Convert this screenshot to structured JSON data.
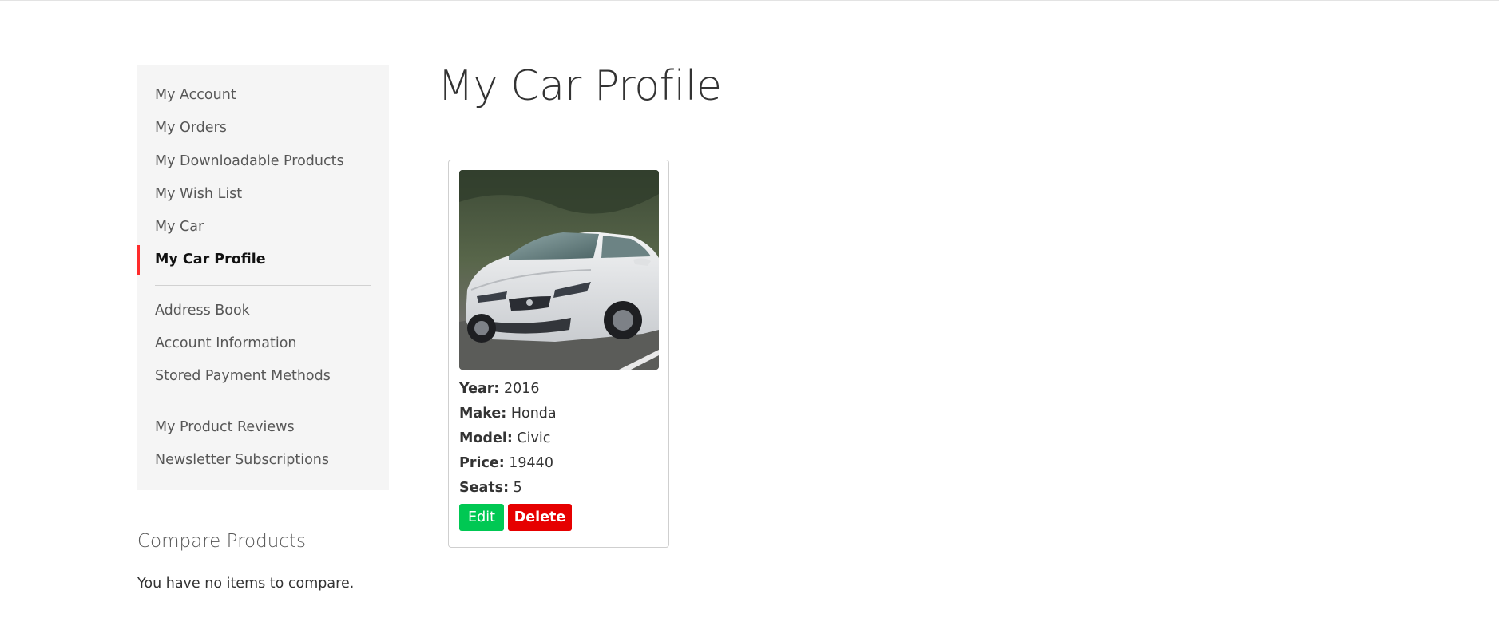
{
  "sidebar": {
    "items": [
      {
        "label": "My Account"
      },
      {
        "label": "My Orders"
      },
      {
        "label": "My Downloadable Products"
      },
      {
        "label": "My Wish List"
      },
      {
        "label": "My Car"
      },
      {
        "label": "My Car Profile",
        "active": true
      },
      {
        "label": "Address Book"
      },
      {
        "label": "Account Information"
      },
      {
        "label": "Stored Payment Methods"
      },
      {
        "label": "My Product Reviews"
      },
      {
        "label": "Newsletter Subscriptions"
      }
    ],
    "accent_color": "#ff2c2c"
  },
  "compare": {
    "title": "Compare Products",
    "empty_text": "You have no items to compare."
  },
  "main": {
    "title": "My Car Profile",
    "car": {
      "image": "car-photo",
      "year_label": "Year:",
      "year": "2016",
      "make_label": "Make:",
      "make": "Honda",
      "model_label": "Model:",
      "model": "Civic",
      "price_label": "Price:",
      "price": "19440",
      "seats_label": "Seats:",
      "seats": "5"
    },
    "edit_label": "Edit",
    "delete_label": "Delete",
    "edit_color": "#00c853",
    "delete_color": "#e60000"
  }
}
